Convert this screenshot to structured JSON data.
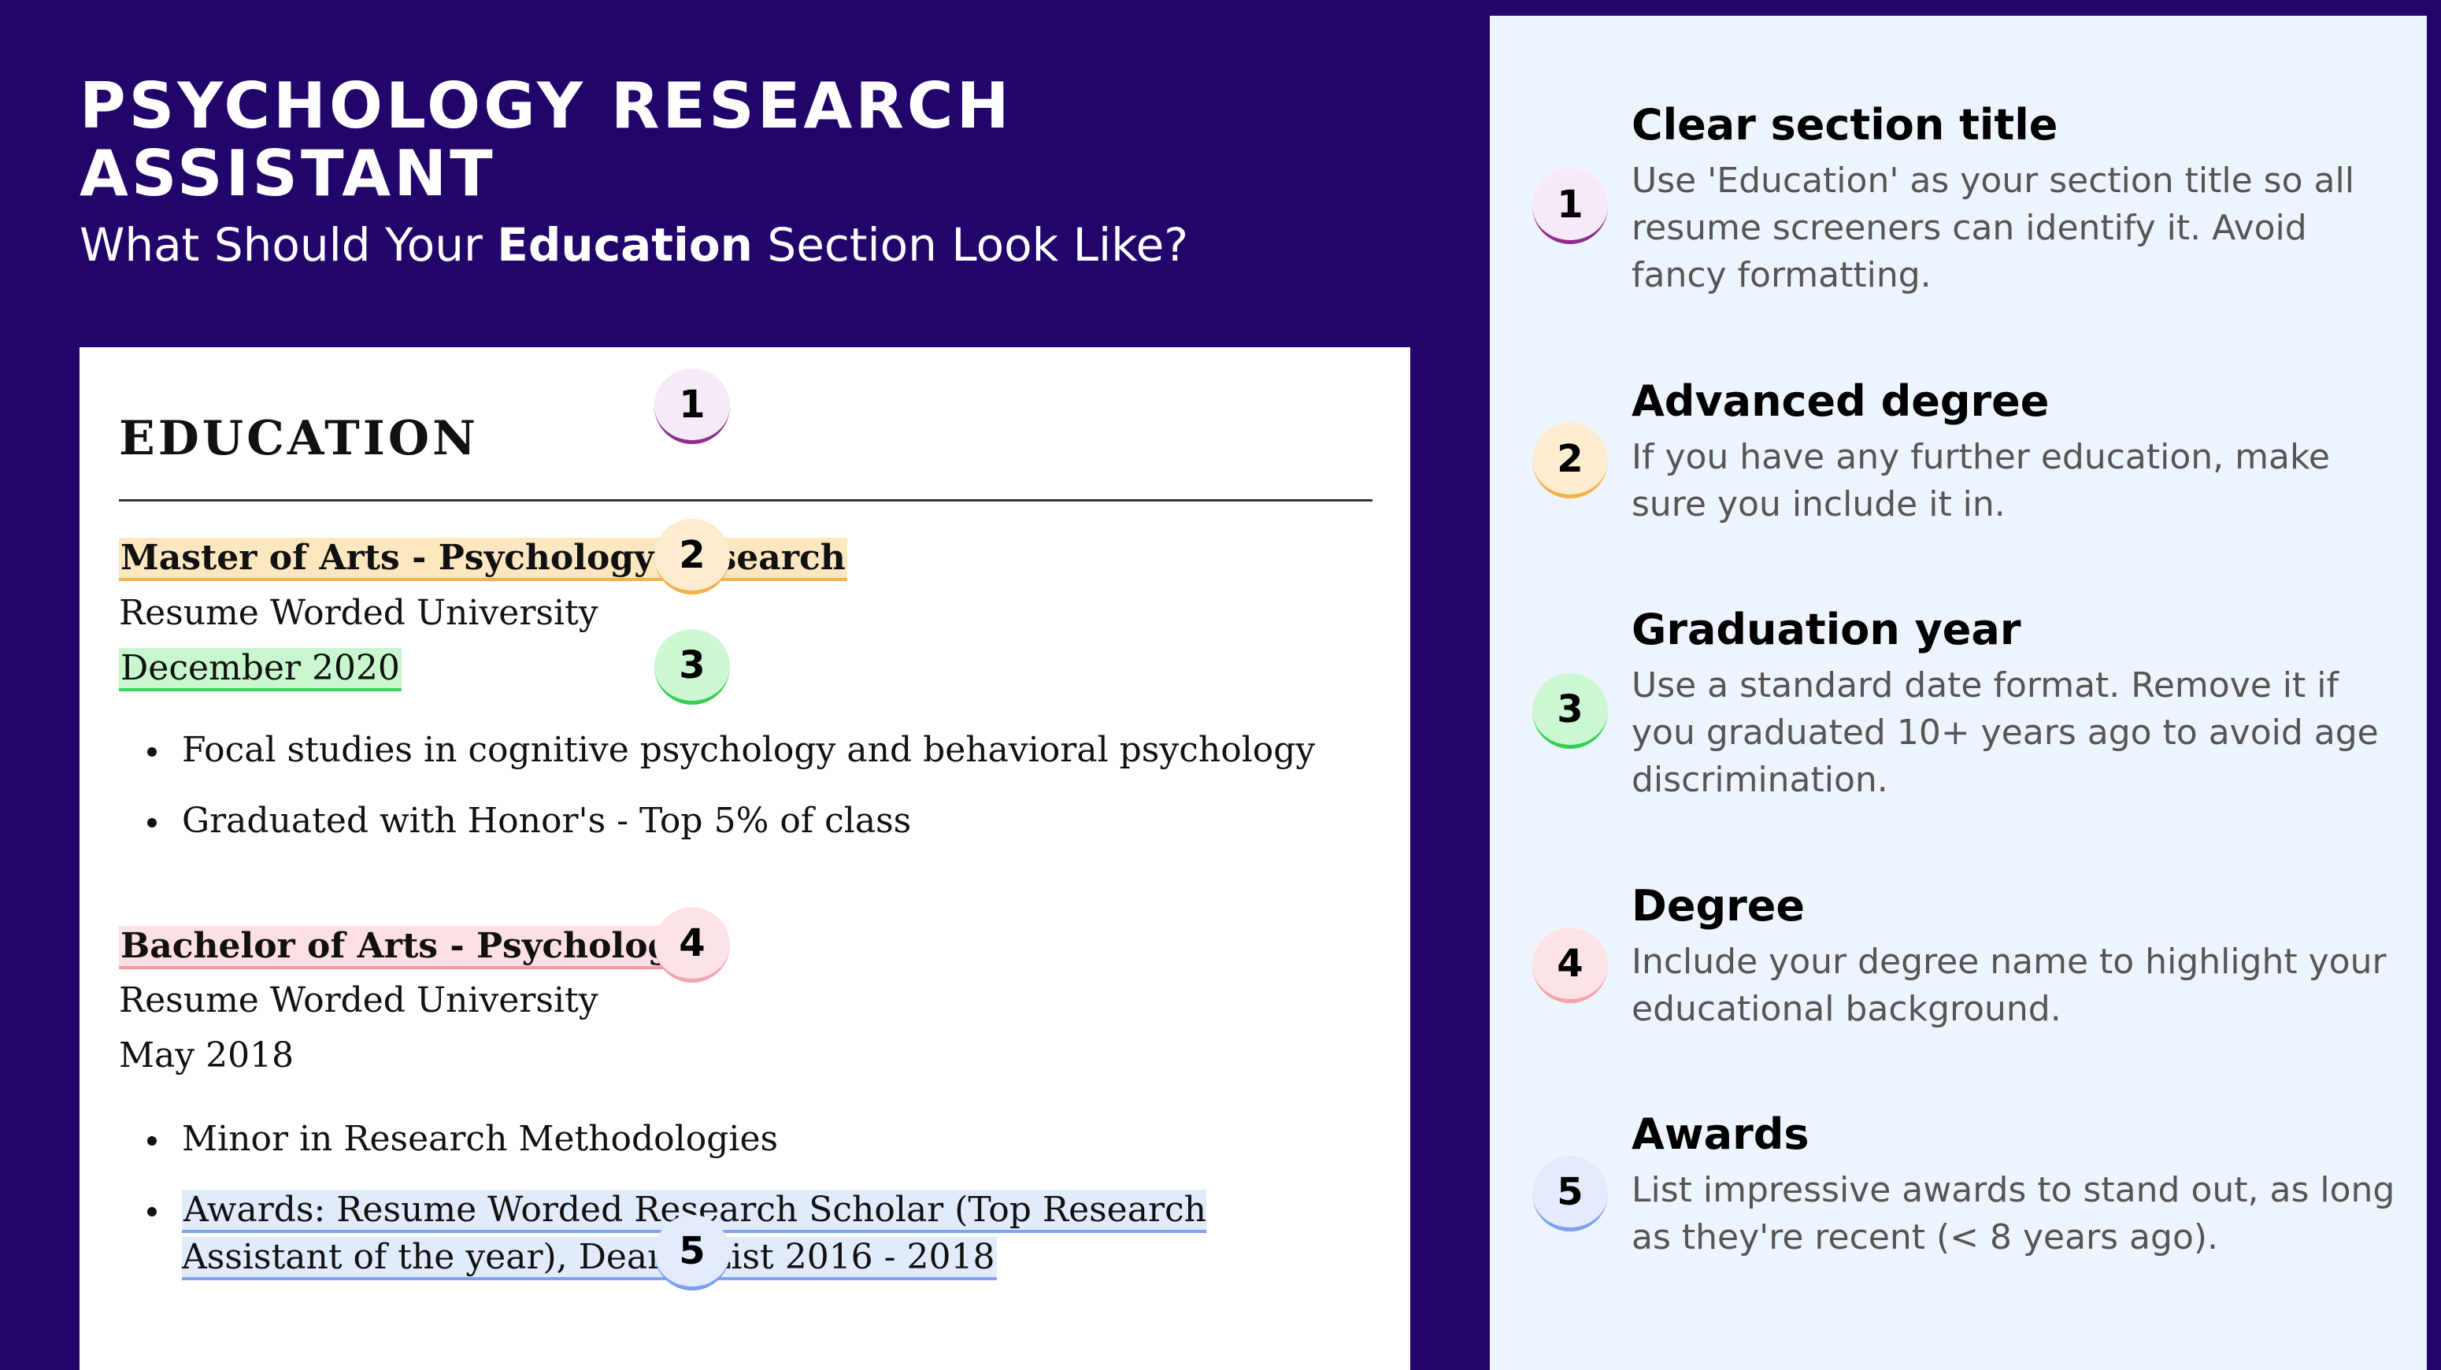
{
  "header": {
    "title": "PSYCHOLOGY RESEARCH ASSISTANT",
    "subtitle_pre": "What Should Your ",
    "subtitle_bold": "Education",
    "subtitle_post": " Section Look Like?"
  },
  "resume": {
    "section_title": "EDUCATION",
    "entries": [
      {
        "degree": "Master of Arts - Psychology Research",
        "school": "Resume Worded University",
        "date": "December 2020",
        "bullets": [
          "Focal studies in cognitive psychology and behavioral psychology",
          "Graduated with Honor's - Top 5% of class"
        ]
      },
      {
        "degree": "Bachelor of Arts - Psychology",
        "school": "Resume Worded University",
        "date": "May 2018",
        "bullets": [
          "Minor in Research Methodologies",
          "Awards: Resume Worded Research Scholar (Top Research Assistant of the year), Dean's List 2016 - 2018"
        ]
      }
    ],
    "badge_numbers": [
      "1",
      "2",
      "3",
      "4",
      "5"
    ]
  },
  "tips": [
    {
      "number": "1",
      "title": "Clear section title",
      "text": "Use 'Education' as your section title so all resume screeners can identify it. Avoid fancy formatting."
    },
    {
      "number": "2",
      "title": "Advanced degree",
      "text": "If you have any further education, make sure you include it in."
    },
    {
      "number": "3",
      "title": "Graduation year",
      "text": "Use a standard date format. Remove it if you graduated 10+ years ago to avoid age discrimination."
    },
    {
      "number": "4",
      "title": "Degree",
      "text": "Include your degree name to highlight your educational background."
    },
    {
      "number": "5",
      "title": "Awards",
      "text": "List impressive awards to stand out, as long as they're recent (< 8 years ago)."
    }
  ],
  "colors": {
    "background": "#22056a",
    "panel": "#eef4fd",
    "badge_1": "#8e2d8f",
    "badge_2": "#f4b04a",
    "badge_3": "#33cf52",
    "badge_4": "#f4a3ad",
    "badge_5": "#7b9ff0"
  }
}
